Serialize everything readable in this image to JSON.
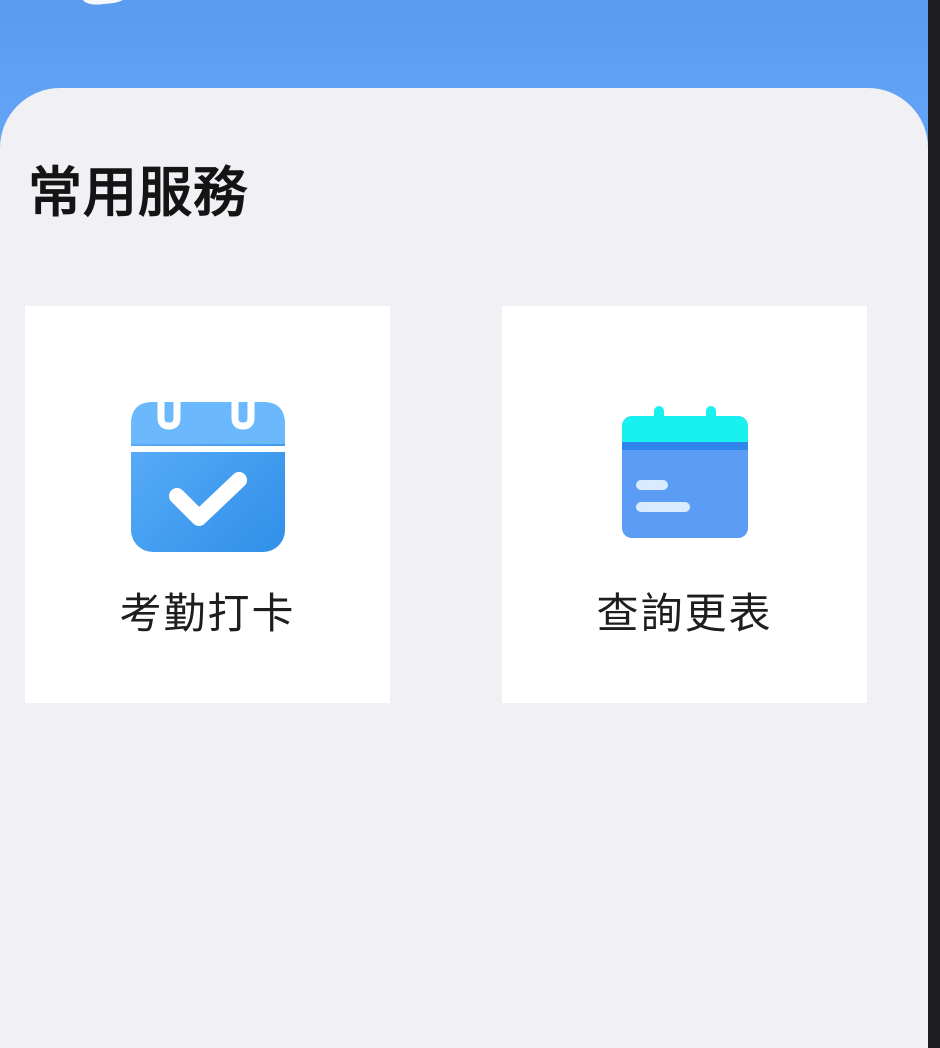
{
  "section": {
    "title": "常用服務"
  },
  "services": [
    {
      "label": "考勤打卡",
      "icon": "calendar-check-icon"
    },
    {
      "label": "查詢更表",
      "icon": "calendar-list-icon"
    }
  ],
  "colors": {
    "header": "#5a9bf0",
    "background": "#f0f0f5",
    "card": "#ffffff",
    "attendance_icon": "#3f9af0",
    "schedule_icon_top": "#19f0f0",
    "schedule_icon_body": "#5b9cf5"
  }
}
